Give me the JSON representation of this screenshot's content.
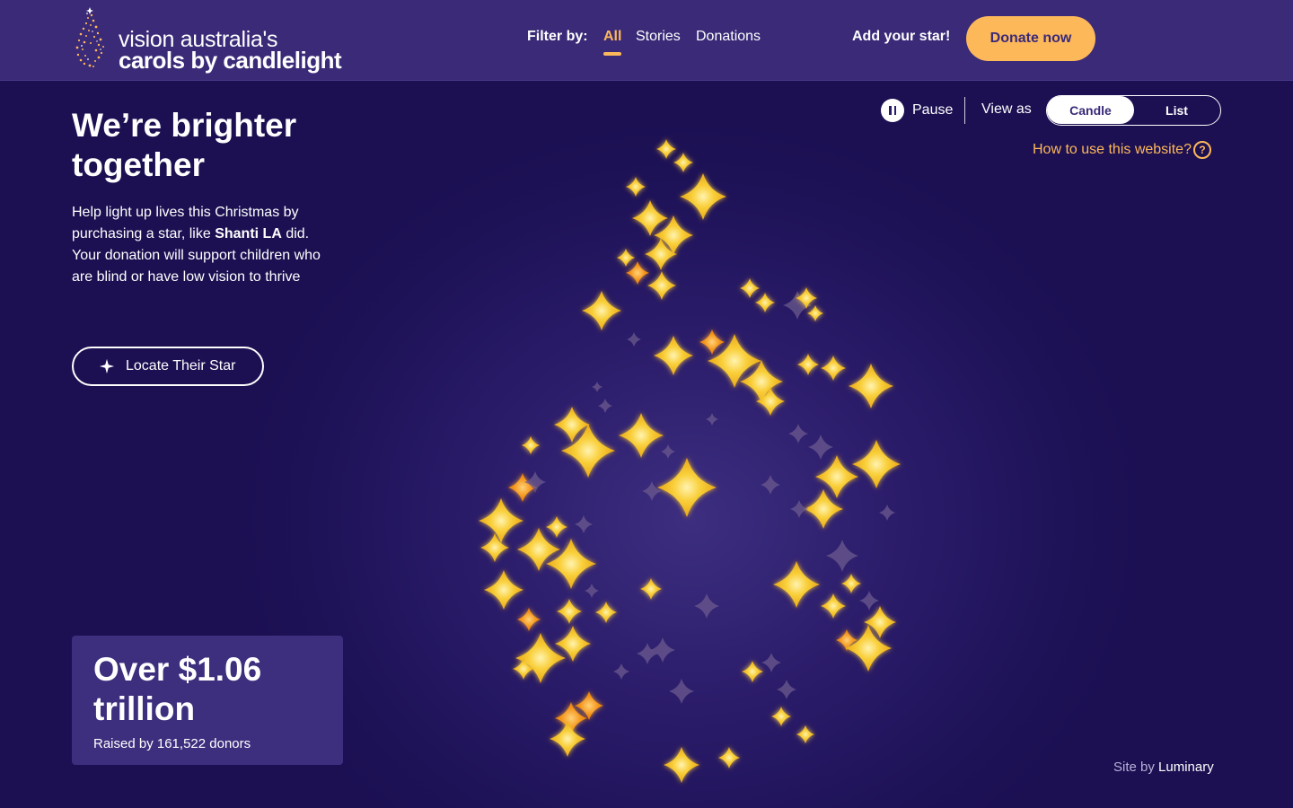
{
  "brand": {
    "line1": "vision australia's",
    "line2": "carols by candlelight"
  },
  "nav": {
    "filter_label": "Filter by:",
    "filters": [
      "All",
      "Stories",
      "Donations"
    ],
    "active_filter": "All",
    "add_star": "Add your star!",
    "donate_label": "Donate now"
  },
  "hero": {
    "title": "We’re brighter together",
    "desc_before": "Help light up lives this Christmas by purchasing a star, like ",
    "desc_name": "Shanti LA",
    "desc_after": " did. Your donation will support children who are blind or have low vision to thrive",
    "locate_label": "Locate Their Star"
  },
  "stats": {
    "amount": "Over $1.06 trillion",
    "sub": "Raised by 161,522 donors"
  },
  "controls": {
    "pause_label": "Pause",
    "view_as_label": "View as",
    "view_options": [
      "Candle",
      "List"
    ],
    "selected_view": "Candle",
    "help_label": "How to use this website?",
    "help_icon": "question-circle-icon"
  },
  "footer": {
    "credit_prefix": "Site by",
    "credit_name": "Luminary"
  },
  "colors": {
    "accent": "#fdb85a",
    "star_gold": "#f7c734",
    "star_orange": "#f59a1b",
    "star_dim": "#6b5a8e",
    "header_bg": "#3a2a78",
    "page_bg": "#1e1258"
  },
  "icons": {
    "logo": "sparkle-flame-icon",
    "locate": "sparkle-icon",
    "pause": "pause-icon"
  }
}
